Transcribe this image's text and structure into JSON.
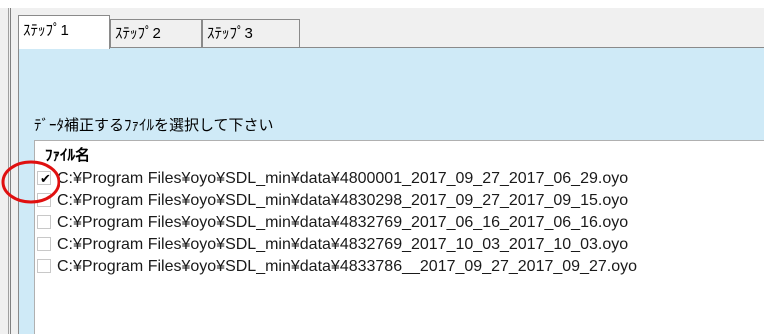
{
  "tabs": [
    {
      "label": "ｽﾃｯﾌﾟ1",
      "active": true
    },
    {
      "label": "ｽﾃｯﾌﾟ2",
      "active": false
    },
    {
      "label": "ｽﾃｯﾌﾟ3",
      "active": false
    }
  ],
  "instruction": "ﾃﾞｰﾀ補正するﾌｧｲﾙを選択して下さい",
  "file_list": {
    "header": "ﾌｧｲﾙ名",
    "rows": [
      {
        "checked": true,
        "path": "C:¥Program Files¥oyo¥SDL_min¥data¥4800001_2017_09_27_2017_06_29.oyo"
      },
      {
        "checked": false,
        "path": "C:¥Program Files¥oyo¥SDL_min¥data¥4830298_2017_09_27_2017_09_15.oyo"
      },
      {
        "checked": false,
        "path": "C:¥Program Files¥oyo¥SDL_min¥data¥4832769_2017_06_16_2017_06_16.oyo"
      },
      {
        "checked": false,
        "path": "C:¥Program Files¥oyo¥SDL_min¥data¥4832769_2017_10_03_2017_10_03.oyo"
      },
      {
        "checked": false,
        "path": "C:¥Program Files¥oyo¥SDL_min¥data¥4833786__2017_09_27_2017_09_27.oyo"
      }
    ]
  },
  "colors": {
    "panel_bg": "#cfeaf7",
    "annotation": "#e01010"
  },
  "checkmark_glyph": "✔"
}
